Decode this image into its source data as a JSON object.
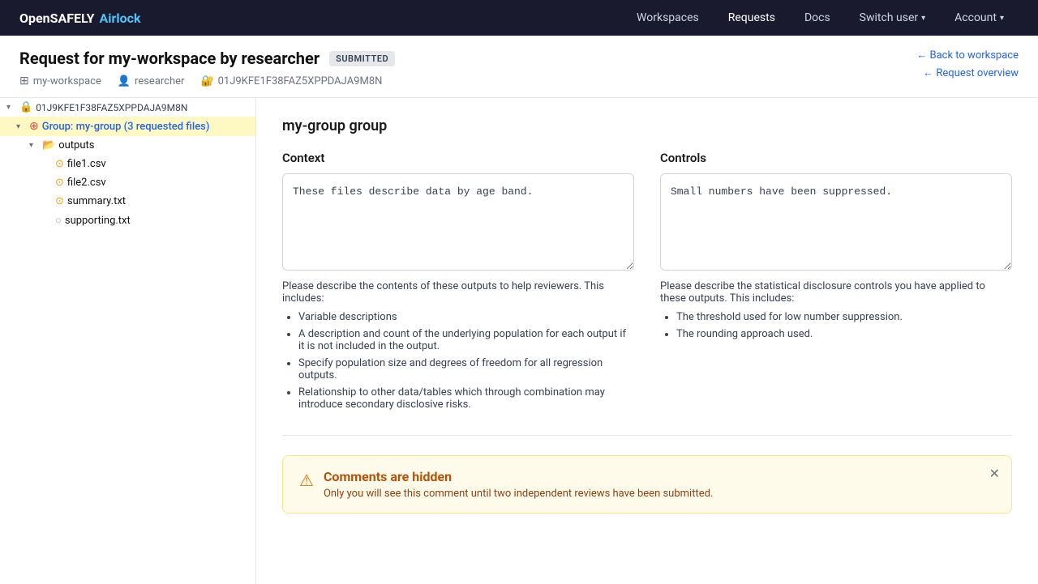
{
  "brand": {
    "open": "OpenSAFELY",
    "airlock": "Airlock"
  },
  "nav": {
    "links": [
      {
        "id": "workspaces",
        "label": "Workspaces",
        "active": false
      },
      {
        "id": "requests",
        "label": "Requests",
        "active": true
      },
      {
        "id": "docs",
        "label": "Docs",
        "active": false
      },
      {
        "id": "switch-user",
        "label": "Switch user",
        "has_chevron": true
      },
      {
        "id": "account",
        "label": "Account",
        "has_chevron": true
      }
    ]
  },
  "page": {
    "title": "Request for my-workspace by researcher",
    "status": "SUBMITTED",
    "workspace": "my-workspace",
    "researcher": "researcher",
    "request_id": "01J9KFE1F38FAZ5XPPDAJA9M8N",
    "back_link": "← Back to workspace",
    "overview_link": "← Request overview"
  },
  "sidebar": {
    "root": {
      "id": "01J9KFE1F38FAZ5XPPDAJA9M8N",
      "label": "01J9KFE1F38FAZ5XPPDAJA9M8N"
    },
    "group": {
      "label": "Group: my-group (3 requested files)"
    },
    "outputs_folder": "outputs",
    "files": [
      {
        "name": "file1.csv",
        "type": "csv"
      },
      {
        "name": "file2.csv",
        "type": "csv"
      },
      {
        "name": "summary.txt",
        "type": "txt"
      },
      {
        "name": "supporting.txt",
        "type": "file"
      }
    ]
  },
  "content": {
    "group_title": "my-group group",
    "context_label": "Context",
    "controls_label": "Controls",
    "context_text": "These files describe data by age band.",
    "controls_text": "Small numbers have been suppressed.",
    "context_help": "Please describe the contents of these outputs to help reviewers. This includes:",
    "context_bullets": [
      "Variable descriptions",
      "A description and count of the underlying population for each output if it is not included in the output.",
      "Specify population size and degrees of freedom for all regression outputs.",
      "Relationship to other data/tables which through combination may introduce secondary disclosive risks."
    ],
    "controls_help": "Please describe the statistical disclosure controls you have applied to these outputs. This includes:",
    "controls_bullets": [
      "The threshold used for low number suppression.",
      "The rounding approach used."
    ],
    "comments_title": "Comments are hidden",
    "comments_sub": "Only you will see this comment until two independent reviews have been submitted."
  }
}
